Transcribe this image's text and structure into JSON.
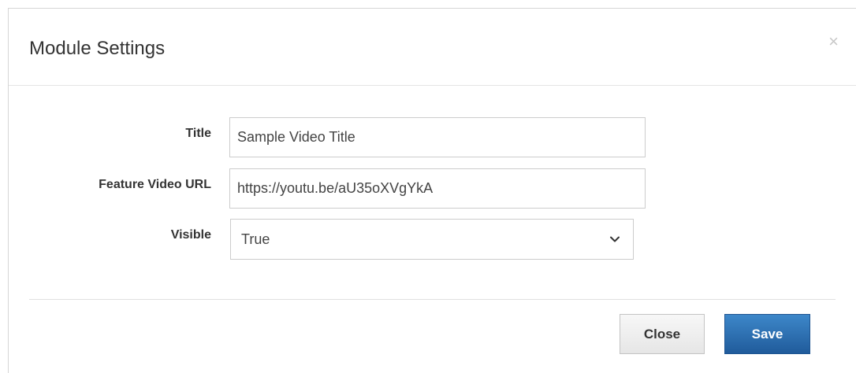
{
  "modal": {
    "title": "Module Settings",
    "close_icon_glyph": "×"
  },
  "form": {
    "fields": [
      {
        "label": "Title",
        "value": "Sample Video Title"
      },
      {
        "label": "Feature Video URL",
        "value": "https://youtu.be/aU35oXVgYkA"
      }
    ],
    "visible": {
      "label": "Visible",
      "selected": "True",
      "icon": "chevron-down-icon"
    }
  },
  "footer": {
    "close_label": "Close",
    "save_label": "Save"
  },
  "colors": {
    "save_button": "#2a6db0",
    "text": "#333333",
    "border": "#cccccc"
  }
}
